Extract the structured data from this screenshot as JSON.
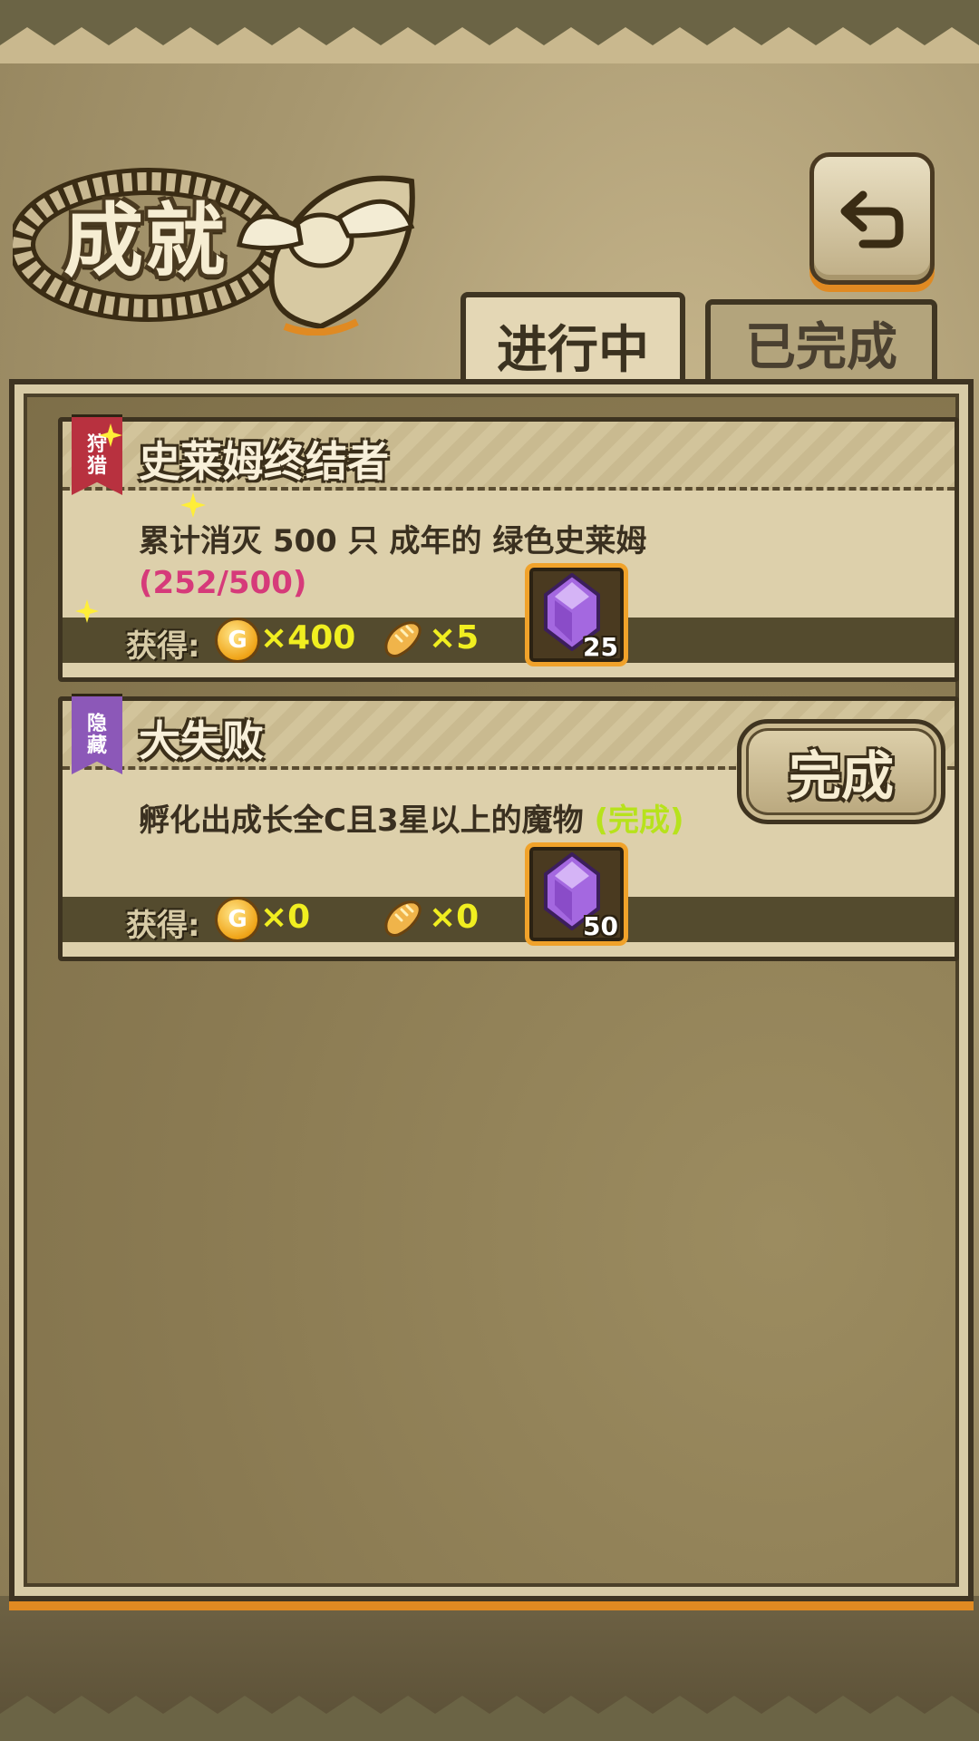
{
  "screen": {
    "title": "成就",
    "back_icon": "return-arrow-icon"
  },
  "tabs": [
    {
      "label": "进行中",
      "active": true
    },
    {
      "label": "已完成",
      "active": false
    }
  ],
  "achievements": [
    {
      "badge": "狩猎",
      "badge_color": "#b8313f",
      "title": "史莱姆终结者",
      "description": "累计消灭 500 只 成年的 绿色史莱姆",
      "progress": "(252/500)",
      "reward_label": "获得:",
      "coins": "×400",
      "bread": "×5",
      "gems": "25"
    },
    {
      "badge": "隐藏",
      "badge_color": "#8c58b8",
      "title": "大失败",
      "description": "孵化出成长全C且3星以上的魔物",
      "status": "(完成)",
      "complete_button": "完成",
      "reward_label": "获得:",
      "coins": "×0",
      "bread": "×0",
      "gems": "50"
    }
  ],
  "colors": {
    "accent_orange": "#e08a22",
    "progress_pink": "#d63a7a",
    "done_green": "#b7e21c",
    "reward_yellow": "#f0ee20"
  }
}
